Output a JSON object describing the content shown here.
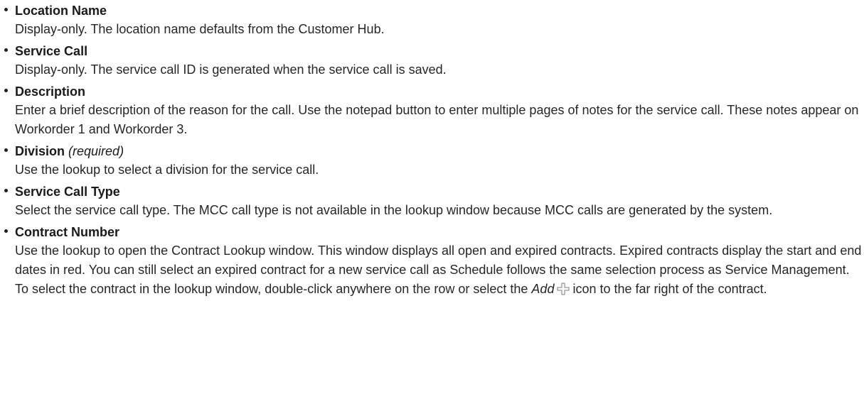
{
  "fields": [
    {
      "term": "Location Name",
      "desc": "Display-only. The location name defaults from the Customer Hub."
    },
    {
      "term": "Service Call",
      "desc": "Display-only. The service call ID is generated when the service call is saved."
    },
    {
      "term": "Description",
      "desc": "Enter a brief description of the reason for the call. Use the notepad button to enter multiple pages of notes for the service call. These notes appear on Workorder 1 and Workorder 3."
    },
    {
      "term": "Division",
      "qualifier": "(required)",
      "desc": "Use the lookup to select a division for the service call."
    },
    {
      "term": "Service Call Type",
      "desc": "Select the service call type. The MCC call type is not available in the lookup window because MCC calls are generated by the system."
    },
    {
      "term": "Contract Number",
      "desc_before": "Use the lookup to open the Contract Lookup window. This window displays all open and expired contracts. Expired contracts display the start and end dates in red. You can still select an expired contract for a new service call as Schedule follows the same selection process as Service Management. To select the contract in the lookup window, double-click anywhere on the row or select the",
      "desc_emphasis": "Add",
      "desc_icon": "add-plus-icon",
      "desc_after": "icon to the far right of the contract."
    }
  ]
}
